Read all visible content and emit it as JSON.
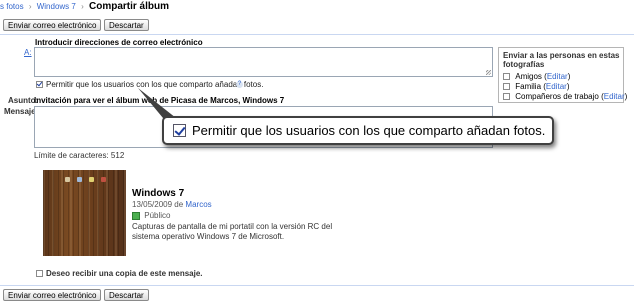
{
  "breadcrumb": {
    "crumb1": "s fotos",
    "sep1": "›",
    "crumb2": "Windows 7",
    "sep2": "›",
    "current": "Compartir álbum"
  },
  "toolbar_top": {
    "send_label": "Enviar correo electrónico",
    "discard_label": "Descartar"
  },
  "form": {
    "emails_heading": "Introducir direcciones de correo electrónico",
    "to_label": "A:",
    "allow_label": "Permitir que los usuarios con los que comparto añadan fotos.",
    "allow_checked": true,
    "help_icon": "help-icon",
    "subject_label": "Asunto:",
    "subject_value": "Invitación para ver el álbum web de Picasa de Marcos, Windows 7",
    "message_label": "Mensaje:",
    "char_limit": "Límite de caracteres: 512",
    "copy_label": "Deseo recibir una copia de este mensaje."
  },
  "send_to": {
    "heading": "Enviar a las personas en estas fotografías",
    "items": [
      {
        "name": "Amigos",
        "edit": "Editar"
      },
      {
        "name": "Familia",
        "edit": "Editar"
      },
      {
        "name": "Compañeros de trabajo",
        "edit": "Editar"
      }
    ]
  },
  "album": {
    "title": "Windows 7",
    "date": "13/05/2009",
    "by_word": "de",
    "owner": "Marcos",
    "visibility": "Público",
    "description": "Capturas de pantalla de mi portatil con la versión RC del sistema operativo Windows 7 de Microsoft."
  },
  "callout": {
    "text": "Permitir que los usuarios con los que comparto añadan fotos."
  },
  "toolbar_bottom": {
    "send_label": "Enviar correo electrónico",
    "discard_label": "Descartar"
  },
  "colors": {
    "link": "#3366cc",
    "divider": "#c9d7f1",
    "public_icon": "#4caf50"
  }
}
